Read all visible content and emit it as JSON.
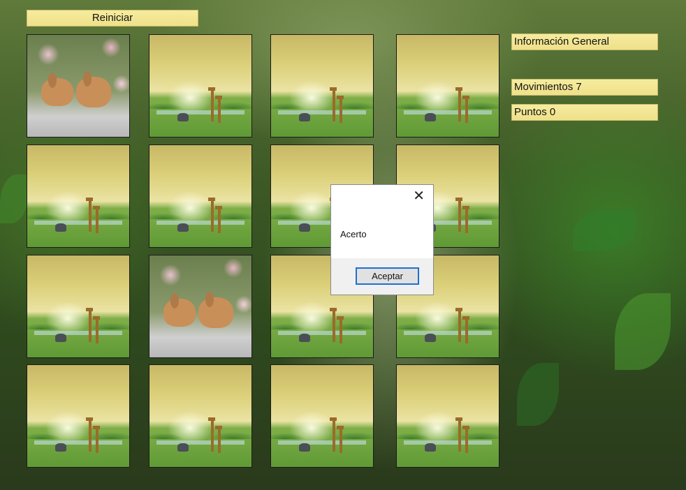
{
  "toolbar": {
    "restart_label": "Reiniciar"
  },
  "info": {
    "title": "Información General",
    "moves_label": "Movimientos 7",
    "points_label": "Puntos 0"
  },
  "board": {
    "rows": 4,
    "cols": 4,
    "cards": [
      {
        "state": "face-up",
        "image": "rabbits"
      },
      {
        "state": "face-down",
        "image": "savanna-giraffes"
      },
      {
        "state": "face-down",
        "image": "savanna-giraffes"
      },
      {
        "state": "face-down",
        "image": "savanna-giraffes"
      },
      {
        "state": "face-down",
        "image": "savanna-giraffes"
      },
      {
        "state": "face-down",
        "image": "savanna-giraffes"
      },
      {
        "state": "face-down",
        "image": "savanna-giraffes"
      },
      {
        "state": "face-down",
        "image": "savanna-giraffes"
      },
      {
        "state": "face-down",
        "image": "savanna-giraffes"
      },
      {
        "state": "face-up",
        "image": "rabbits"
      },
      {
        "state": "face-down",
        "image": "savanna-giraffes"
      },
      {
        "state": "face-down",
        "image": "savanna-giraffes"
      },
      {
        "state": "face-down",
        "image": "savanna-giraffes"
      },
      {
        "state": "face-down",
        "image": "savanna-giraffes"
      },
      {
        "state": "face-down",
        "image": "savanna-giraffes"
      },
      {
        "state": "face-down",
        "image": "savanna-giraffes"
      }
    ]
  },
  "dialog": {
    "message": "Acerto",
    "ok_label": "Aceptar",
    "close_icon": "close-icon"
  },
  "colors": {
    "label_bg": "#f3e693",
    "dialog_button_border": "#1f6fd1"
  }
}
